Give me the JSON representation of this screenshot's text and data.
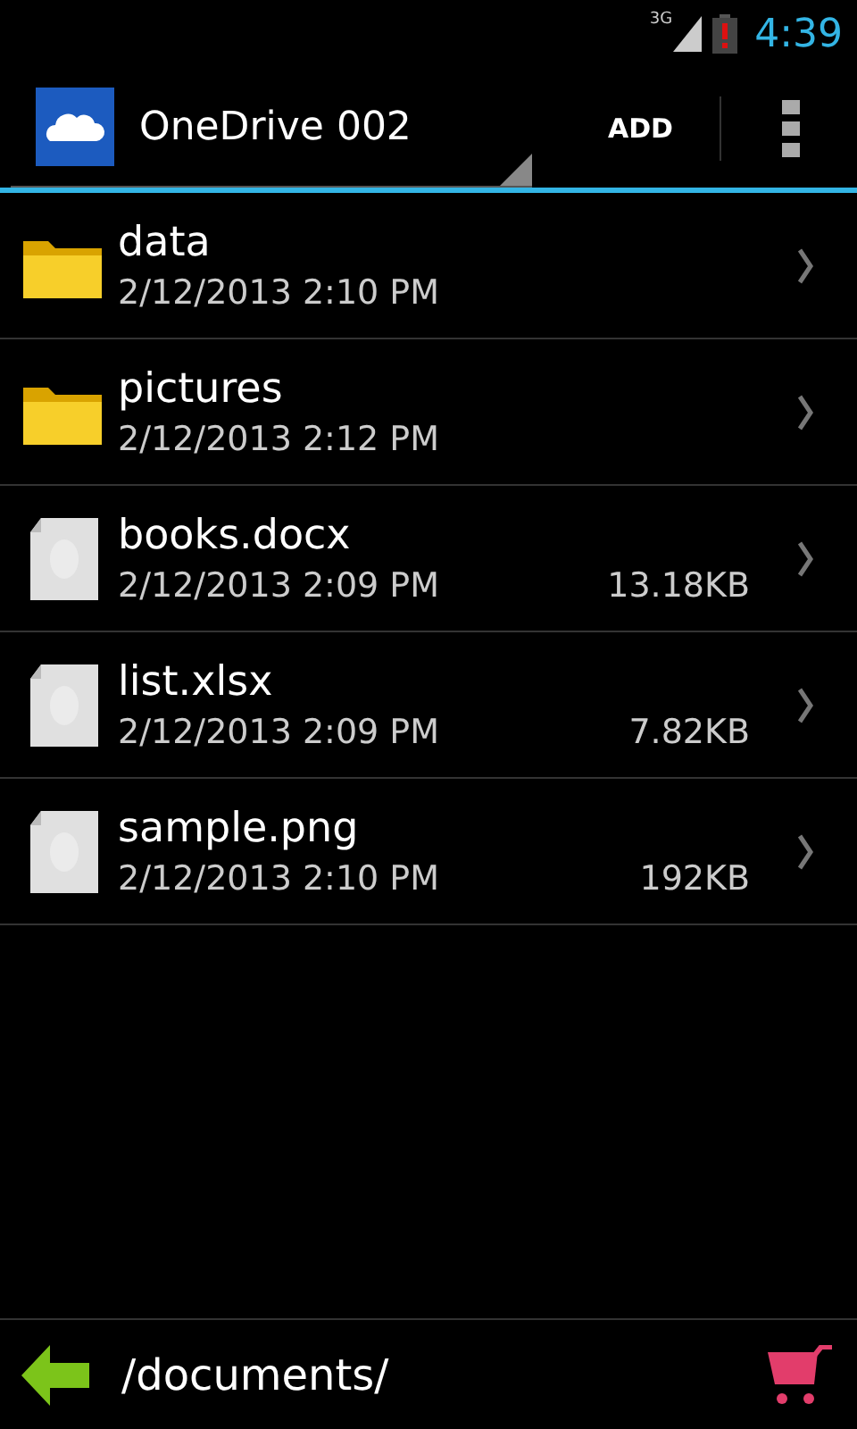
{
  "status_bar": {
    "network": "3G",
    "time": "4:39"
  },
  "action_bar": {
    "account": "OneDrive 002",
    "add": "ADD"
  },
  "files": [
    {
      "kind": "folder",
      "name": "data",
      "date": "2/12/2013 2:10 PM"
    },
    {
      "kind": "folder",
      "name": "pictures",
      "date": "2/12/2013 2:12 PM"
    },
    {
      "kind": "file",
      "name": "books.docx",
      "date": "2/12/2013 2:09 PM",
      "size": "13.18KB"
    },
    {
      "kind": "file",
      "name": "list.xlsx",
      "date": "2/12/2013 2:09 PM",
      "size": "7.82KB"
    },
    {
      "kind": "file",
      "name": "sample.png",
      "date": "2/12/2013 2:10 PM",
      "size": "192KB"
    }
  ],
  "bottom_bar": {
    "path": "/documents/"
  }
}
